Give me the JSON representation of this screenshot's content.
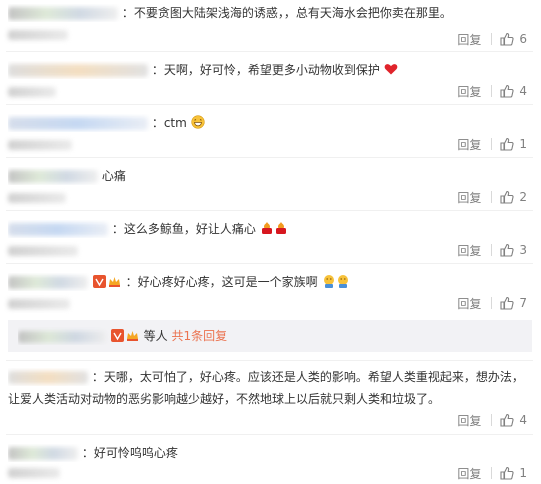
{
  "comments": [
    {
      "text": "：不要贪图大陆架浅海的诱惑，，总有天海水会把你卖在那里。",
      "reply": "回复",
      "likes": "6"
    },
    {
      "text": "：天啊，好可怜，希望更多小动物收到保护",
      "reply": "回复",
      "likes": "4"
    },
    {
      "text": "：ctm",
      "reply": "回复",
      "likes": "1"
    },
    {
      "text": "心痛",
      "reply": "回复",
      "likes": "2"
    },
    {
      "text": "：这么多鲸鱼，好让人痛心",
      "reply": "回复",
      "likes": "3"
    },
    {
      "text": "：好心疼好心疼，这可是一个家族啊",
      "reply": "回复",
      "likes": "7"
    },
    {
      "line1": "：天哪，太可怕了，好心疼。应该还是人类的影响。希望人类重视起来，想办法，",
      "line2": "让爱人类活动对动物的恶劣影响越少越好，不然地球上以后就只剩人类和垃圾了。",
      "reply": "回复",
      "likes": "4"
    },
    {
      "text": "：好可怜呜呜心疼",
      "reply": "回复",
      "likes": "1"
    }
  ],
  "sub_replies": {
    "people": "等人",
    "count_link": "共1条回复"
  },
  "icons": {
    "like": "thumb-up-icon",
    "heart": "red-heart-emoji",
    "smile": "laughing-emoji",
    "candle": "red-lantern-emoji",
    "crying": "crying-emoji"
  },
  "colors": {
    "link": "#eb7350",
    "muted": "#808080",
    "text": "#333333"
  }
}
